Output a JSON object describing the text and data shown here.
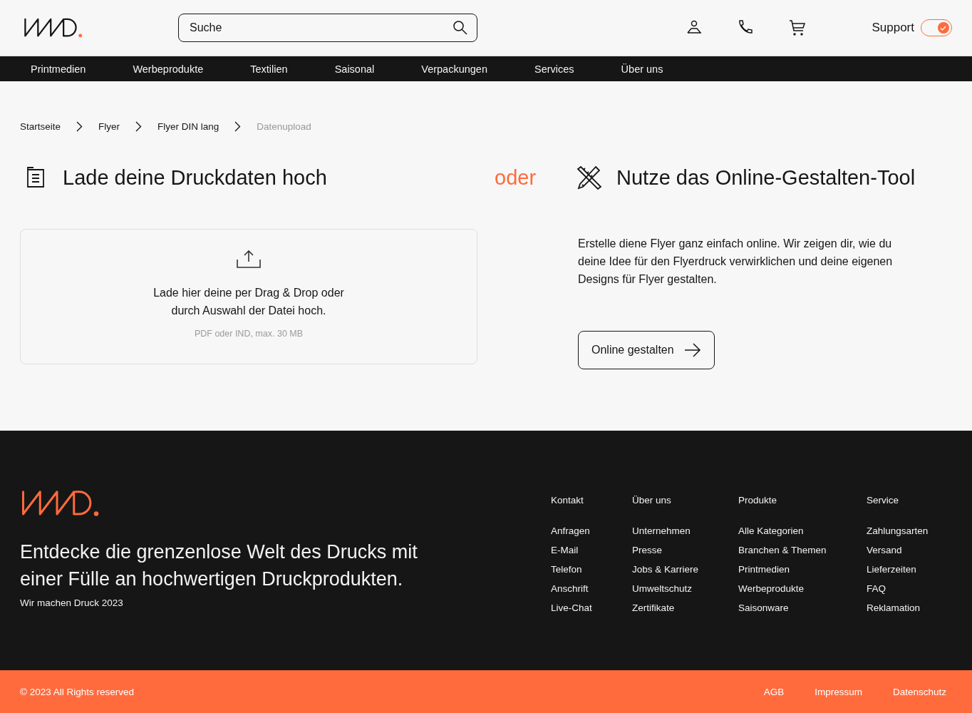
{
  "header": {
    "search": {
      "placeholder": "Suche"
    },
    "support": {
      "label": "Support",
      "on": true
    }
  },
  "nav": [
    "Printmedien",
    "Werbeprodukte",
    "Textilien",
    "Saisonal",
    "Verpackungen",
    "Services",
    "Über uns"
  ],
  "breadcrumb": [
    {
      "label": "Startseite",
      "current": false
    },
    {
      "label": "Flyer",
      "current": false
    },
    {
      "label": "Flyer DIN lang",
      "current": false
    },
    {
      "label": "Datenupload",
      "current": true
    }
  ],
  "upload": {
    "title": "Lade deine Druckdaten hoch",
    "text": "Lade hier deine per Drag & Drop oder durch Auswahl der Datei hoch.",
    "hint": "PDF oder IND, max. 30 MB"
  },
  "separator": "oder",
  "designer": {
    "title": "Nutze das Online-Gestalten-Tool",
    "text": "Erstelle diene Flyer ganz einfach online. Wir zeigen dir, wie du deine Idee für den Flyerdruck verwirklichen und deine eigenen Designs für Flyer gestalten.",
    "button": "Online gestalten"
  },
  "footer": {
    "tagline": "Entdecke die grenzenlose Welt des Drucks mit einer Fülle an hochwertigen Druckprodukten.",
    "note": "Wir machen Druck 2023",
    "columns": [
      {
        "title": "Kontakt",
        "links": [
          "Anfragen",
          "E-Mail",
          "Telefon",
          "Anschrift",
          "Live-Chat"
        ]
      },
      {
        "title": "Über uns",
        "links": [
          "Unternehmen",
          "Presse",
          "Jobs & Karriere",
          "Umweltschutz",
          "Zertifikate"
        ]
      },
      {
        "title": "Produkte",
        "links": [
          "Alle Kategorien",
          "Branchen & Themen",
          "Printmedien",
          "Werbeprodukte",
          "Saisonware"
        ]
      },
      {
        "title": "Service",
        "links": [
          "Zahlungsarten",
          "Versand",
          "Lieferzeiten",
          "FAQ",
          "Reklamation"
        ]
      }
    ]
  },
  "bottom_bar": {
    "copyright": "© 2023 All Rights reserved",
    "links": [
      "AGB",
      "Impressum",
      "Datenschutz"
    ]
  }
}
